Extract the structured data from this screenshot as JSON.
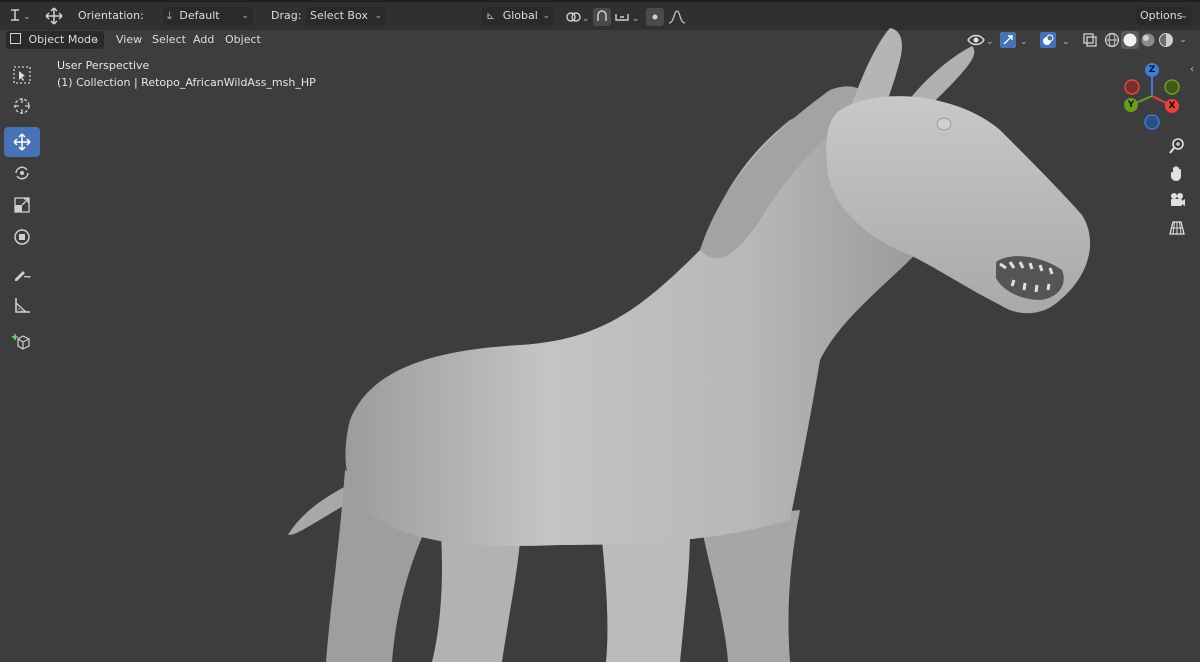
{
  "topbar": {
    "orientation_label": "Orientation:",
    "orientation_value": "Default",
    "drag_label": "Drag:",
    "drag_value": "Select Box",
    "transform_value": "Global",
    "options_label": "Options"
  },
  "header": {
    "mode": "Object Mode",
    "menus": [
      "View",
      "Select",
      "Add",
      "Object"
    ]
  },
  "viewport": {
    "perspective": "User Perspective",
    "collection": "(1) Collection | Retopo_AfricanWildAss_msh_HP"
  },
  "gizmo": {
    "axes": [
      "Z",
      "X",
      "Y"
    ]
  },
  "colors": {
    "accent": "#4772b3",
    "x_axis": "#e8423f",
    "y_axis": "#6b9c22",
    "z_axis": "#3b7bd9",
    "background": "#3d3d3d",
    "model": "#bdbdbd"
  },
  "icons": {
    "tools": [
      "select-box-icon",
      "cursor-icon",
      "move-icon",
      "rotate-icon",
      "scale-icon",
      "transform-icon",
      "annotate-icon",
      "measure-icon",
      "add-cube-icon"
    ],
    "nav": [
      "zoom-icon",
      "pan-hand-icon",
      "camera-icon",
      "perspective-grid-icon"
    ]
  }
}
